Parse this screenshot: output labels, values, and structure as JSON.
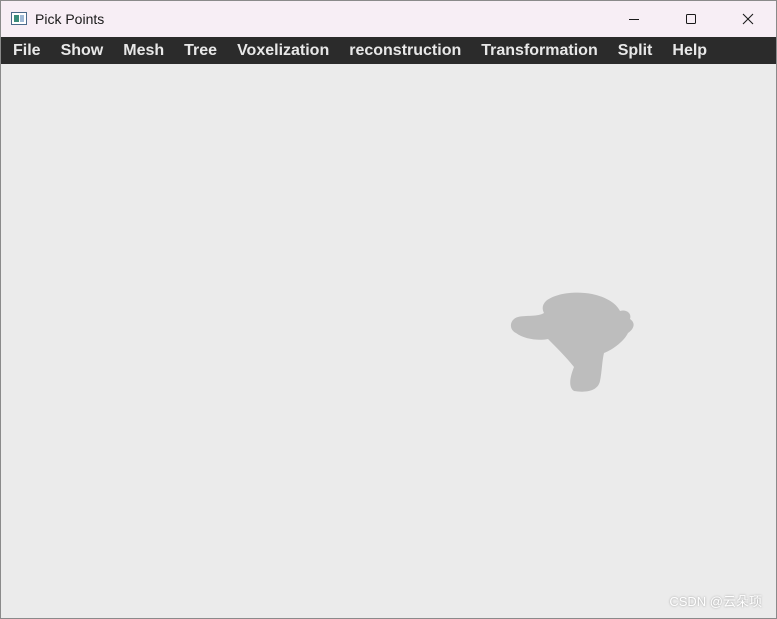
{
  "window": {
    "title": "Pick Points",
    "app_icon": "window-app-icon",
    "controls": {
      "minimize_icon": "minimize-icon",
      "maximize_icon": "maximize-icon",
      "close_icon": "close-icon"
    }
  },
  "menubar": {
    "items": [
      {
        "label": "File"
      },
      {
        "label": "Show"
      },
      {
        "label": "Mesh"
      },
      {
        "label": "Tree"
      },
      {
        "label": "Voxelization"
      },
      {
        "label": "reconstruction"
      },
      {
        "label": "Transformation"
      },
      {
        "label": "Split"
      },
      {
        "label": "Help"
      }
    ]
  },
  "viewport": {
    "background_color": "#ebebeb",
    "model_color": "#bdbdbd",
    "watermark": "CSDN @云朵项"
  },
  "colors": {
    "titlebar": "#f7eef5",
    "menubar": "#2b2b2b",
    "menu_text": "#e8e8e8"
  }
}
